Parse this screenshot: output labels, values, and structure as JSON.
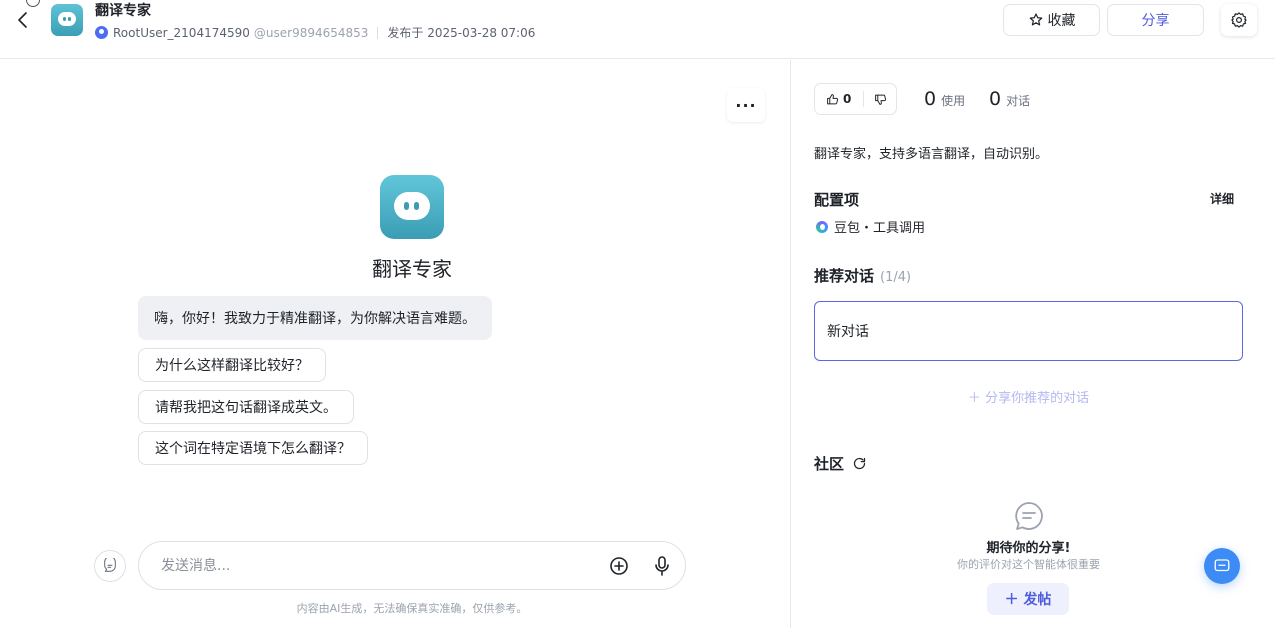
{
  "header": {
    "app_title": "翻译专家",
    "author": "RootUser_2104174590",
    "handle": "@user9894654853",
    "published": "发布于 2025-03-28 07:06",
    "favorite_label": "收藏",
    "share_label": "分享"
  },
  "chat": {
    "bot_name": "翻译专家",
    "greeting": "嗨，你好！我致力于精准翻译，为你解决语言难题。",
    "suggestions": [
      "为什么这样翻译比较好？",
      "请帮我把这句话翻译成英文。",
      "这个词在特定语境下怎么翻译？"
    ],
    "input_placeholder": "发送消息...",
    "disclaimer": "内容由AI生成，无法确保真实准确，仅供参考。"
  },
  "sidebar": {
    "likes": "0",
    "uses_count": "0",
    "uses_label": "使用",
    "chats_count": "0",
    "chats_label": "对话",
    "description": "翻译专家，支持多语言翻译，自动识别。",
    "config_title": "配置项",
    "detail_link": "详细",
    "model": "豆包・工具调用",
    "recommend_title": "推荐对话",
    "recommend_count": "(1/4)",
    "recommend_item": "新对话",
    "share_recommend": "分享你推荐的对话",
    "community_title": "社区",
    "community_empty_title": "期待你的分享!",
    "community_empty_sub": "你的评价对这个智能体很重要",
    "post_label": "发帖"
  },
  "colors": {
    "accent": "#4e5bdc",
    "logo": "#3a9fb6",
    "float_button": "#3d8cf5"
  }
}
